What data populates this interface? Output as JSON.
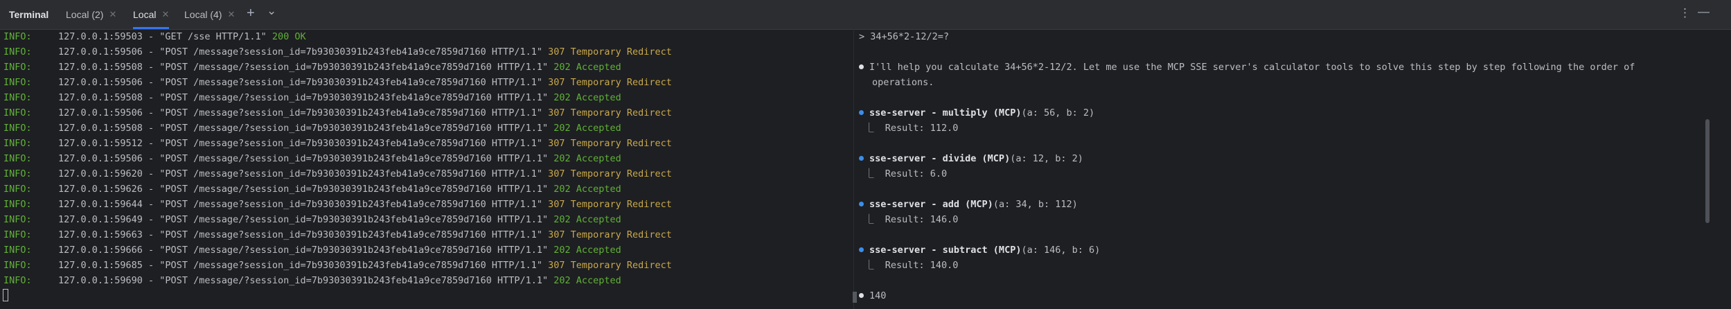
{
  "toolbar": {
    "title": "Terminal",
    "tabs": [
      {
        "label": "Local (2)",
        "close": "✕"
      },
      {
        "label": "Local",
        "close": "✕"
      },
      {
        "label": "Local (4)",
        "close": "✕"
      }
    ],
    "add_icon": "+",
    "chevron_icon": "⌄",
    "more_icon": "⋮",
    "minimize_icon": "—"
  },
  "log": [
    {
      "level": "INFO:",
      "addr": "127.0.0.1:59503",
      "req": " - \"GET /sse HTTP/1.1\" ",
      "status": "200 OK",
      "kind": "s202"
    },
    {
      "level": "INFO:",
      "addr": "127.0.0.1:59506",
      "req": " - \"POST /message?session_id=7b93030391b243feb41a9ce7859d7160 HTTP/1.1\" ",
      "status": "307 Temporary Redirect",
      "kind": "s307"
    },
    {
      "level": "INFO:",
      "addr": "127.0.0.1:59508",
      "req": " - \"POST /message/?session_id=7b93030391b243feb41a9ce7859d7160 HTTP/1.1\" ",
      "status": "202 Accepted",
      "kind": "s202"
    },
    {
      "level": "INFO:",
      "addr": "127.0.0.1:59506",
      "req": " - \"POST /message?session_id=7b93030391b243feb41a9ce7859d7160 HTTP/1.1\" ",
      "status": "307 Temporary Redirect",
      "kind": "s307"
    },
    {
      "level": "INFO:",
      "addr": "127.0.0.1:59508",
      "req": " - \"POST /message/?session_id=7b93030391b243feb41a9ce7859d7160 HTTP/1.1\" ",
      "status": "202 Accepted",
      "kind": "s202"
    },
    {
      "level": "INFO:",
      "addr": "127.0.0.1:59506",
      "req": " - \"POST /message?session_id=7b93030391b243feb41a9ce7859d7160 HTTP/1.1\" ",
      "status": "307 Temporary Redirect",
      "kind": "s307"
    },
    {
      "level": "INFO:",
      "addr": "127.0.0.1:59508",
      "req": " - \"POST /message/?session_id=7b93030391b243feb41a9ce7859d7160 HTTP/1.1\" ",
      "status": "202 Accepted",
      "kind": "s202"
    },
    {
      "level": "INFO:",
      "addr": "127.0.0.1:59512",
      "req": " - \"POST /message?session_id=7b93030391b243feb41a9ce7859d7160 HTTP/1.1\" ",
      "status": "307 Temporary Redirect",
      "kind": "s307"
    },
    {
      "level": "INFO:",
      "addr": "127.0.0.1:59506",
      "req": " - \"POST /message/?session_id=7b93030391b243feb41a9ce7859d7160 HTTP/1.1\" ",
      "status": "202 Accepted",
      "kind": "s202"
    },
    {
      "level": "INFO:",
      "addr": "127.0.0.1:59620",
      "req": " - \"POST /message?session_id=7b93030391b243feb41a9ce7859d7160 HTTP/1.1\" ",
      "status": "307 Temporary Redirect",
      "kind": "s307"
    },
    {
      "level": "INFO:",
      "addr": "127.0.0.1:59626",
      "req": " - \"POST /message/?session_id=7b93030391b243feb41a9ce7859d7160 HTTP/1.1\" ",
      "status": "202 Accepted",
      "kind": "s202"
    },
    {
      "level": "INFO:",
      "addr": "127.0.0.1:59644",
      "req": " - \"POST /message?session_id=7b93030391b243feb41a9ce7859d7160 HTTP/1.1\" ",
      "status": "307 Temporary Redirect",
      "kind": "s307"
    },
    {
      "level": "INFO:",
      "addr": "127.0.0.1:59649",
      "req": " - \"POST /message/?session_id=7b93030391b243feb41a9ce7859d7160 HTTP/1.1\" ",
      "status": "202 Accepted",
      "kind": "s202"
    },
    {
      "level": "INFO:",
      "addr": "127.0.0.1:59663",
      "req": " - \"POST /message?session_id=7b93030391b243feb41a9ce7859d7160 HTTP/1.1\" ",
      "status": "307 Temporary Redirect",
      "kind": "s307"
    },
    {
      "level": "INFO:",
      "addr": "127.0.0.1:59666",
      "req": " - \"POST /message/?session_id=7b93030391b243feb41a9ce7859d7160 HTTP/1.1\" ",
      "status": "202 Accepted",
      "kind": "s202"
    },
    {
      "level": "INFO:",
      "addr": "127.0.0.1:59685",
      "req": " - \"POST /message?session_id=7b93030391b243feb41a9ce7859d7160 HTTP/1.1\" ",
      "status": "307 Temporary Redirect",
      "kind": "s307"
    },
    {
      "level": "INFO:",
      "addr": "127.0.0.1:59690",
      "req": " - \"POST /message/?session_id=7b93030391b243feb41a9ce7859d7160 HTTP/1.1\" ",
      "status": "202 Accepted",
      "kind": "s202"
    }
  ],
  "chat": {
    "prompt": "> 34+56*2-12/2=?",
    "intro_1": "I'll help you calculate 34+56*2-12/2. Let me use the MCP SSE server's calculator tools to solve this step by step following the order of",
    "intro_2": "operations.",
    "calls": [
      {
        "name": "sse-server - multiply (MCP)",
        "args": "(a: 56, b: 2)",
        "result": "⎿  Result: 112.0"
      },
      {
        "name": "sse-server - divide (MCP)",
        "args": "(a: 12, b: 2)",
        "result": "⎿  Result: 6.0"
      },
      {
        "name": "sse-server - add (MCP)",
        "args": "(a: 34, b: 112)",
        "result": "⎿  Result: 146.0"
      },
      {
        "name": "sse-server - subtract (MCP)",
        "args": "(a: 146, b: 6)",
        "result": "⎿  Result: 140.0"
      }
    ],
    "answer": "140"
  },
  "colors": {
    "accent": "#3574f0",
    "ok": "#5fb236",
    "redirect": "#c9a94b",
    "tool_bullet": "#3b8eea"
  }
}
